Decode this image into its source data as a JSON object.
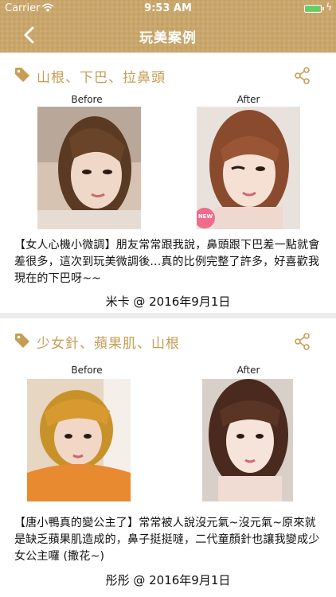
{
  "status_bar": {
    "carrier": "Carrier",
    "time": "9:53 AM"
  },
  "nav": {
    "title": "玩美案例",
    "back_icon": "chevron-left-icon"
  },
  "cases": [
    {
      "tags": "山根、下巴、拉鼻頭",
      "before_label": "Before",
      "after_label": "After",
      "after_badge": "NEW",
      "description": "【女人心機小微調】朋友常常跟我說，鼻頭跟下巴差一點就會差很多，這次到玩美微調後...真的比例完整了許多，好喜歡我現在的下巴呀~~",
      "byline": "米卡 @ 2016年9月1日"
    },
    {
      "tags": "少女針、蘋果肌、山根",
      "before_label": "Before",
      "after_label": "After",
      "description": "【唐小鴨真的變公主了】常常被人說沒元氣~沒元氣~原來就是缺乏蘋果肌造成的，鼻子挺挺噠，二代童顏針也讓我變成少女公主囉 (撒花~)",
      "byline": "彤彤 @ 2016年9月1日"
    }
  ],
  "colors": {
    "header_gold": "#c9a66b",
    "tag_gold": "#c79d56",
    "battery_green": "#4cd964",
    "new_badge": "#f06b8c"
  }
}
